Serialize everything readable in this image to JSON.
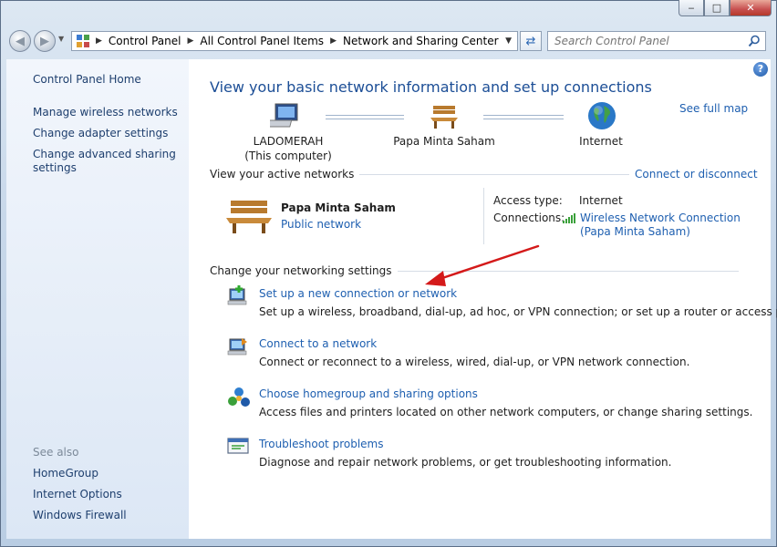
{
  "window": {
    "caption_buttons": {
      "minimize": "‒",
      "maximize": "□",
      "close": "✕"
    }
  },
  "nav": {
    "breadcrumb": [
      "Control Panel",
      "All Control Panel Items",
      "Network and Sharing Center"
    ],
    "search_placeholder": "Search Control Panel"
  },
  "sidebar": {
    "home": "Control Panel Home",
    "links": [
      "Manage wireless networks",
      "Change adapter settings",
      "Change advanced sharing",
      "settings"
    ],
    "see_also_label": "See also",
    "see_also": [
      "HomeGroup",
      "Internet Options",
      "Windows Firewall"
    ]
  },
  "main": {
    "title": "View your basic network information and set up connections",
    "see_full_map": "See full map",
    "map": {
      "computer": {
        "name": "LADOMERAH",
        "sub": "(This computer)"
      },
      "network": "Papa Minta Saham",
      "internet": "Internet"
    },
    "active_networks_label": "View your active networks",
    "connect_or_disconnect": "Connect or disconnect",
    "active": {
      "name": "Papa Minta Saham",
      "type": "Public network",
      "access_type_label": "Access type:",
      "access_type_value": "Internet",
      "connections_label": "Connections:",
      "connection_link_1": "Wireless Network Connection",
      "connection_link_2": "(Papa Minta Saham)"
    },
    "change_settings_label": "Change your networking settings",
    "tasks": [
      {
        "title": "Set up a new connection or network",
        "desc": "Set up a wireless, broadband, dial-up, ad hoc, or VPN connection; or set up a router or access point."
      },
      {
        "title": "Connect to a network",
        "desc": "Connect or reconnect to a wireless, wired, dial-up, or VPN network connection."
      },
      {
        "title": "Choose homegroup and sharing options",
        "desc": "Access files and printers located on other network computers, or change sharing settings."
      },
      {
        "title": "Troubleshoot problems",
        "desc": "Diagnose and repair network problems, or get troubleshooting information."
      }
    ]
  },
  "colors": {
    "link": "#1e5fb0",
    "title": "#1c4e96",
    "annotation_arrow": "#d41a1a"
  }
}
